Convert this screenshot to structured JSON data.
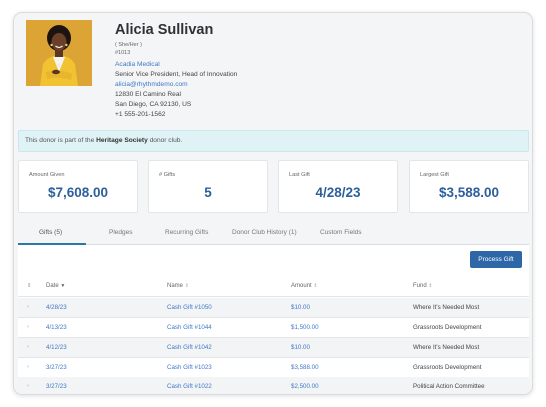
{
  "profile": {
    "name": "Alicia Sullivan",
    "pronouns": "( She/Her )",
    "id": "#1013",
    "organization": "Acadia Medical",
    "title": "Senior Vice President, Head of Innovation",
    "email": "alicia@rhythmdemo.com",
    "address_line1": "12830 El Camino Real",
    "address_line2": "San Diego, CA 92130, US",
    "phone": "+1 555-201-1562"
  },
  "banner": {
    "prefix": "This donor is part of the ",
    "club": "Heritage Society",
    "suffix": " donor club."
  },
  "stats": [
    {
      "label": "Amount Given",
      "value": "$7,608.00"
    },
    {
      "label": "# Gifts",
      "value": "5"
    },
    {
      "label": "Last Gift",
      "value": "4/28/23"
    },
    {
      "label": "Largest Gift",
      "value": "$3,588.00"
    }
  ],
  "tabs": [
    {
      "label": "Gifts (5)"
    },
    {
      "label": "Pledges"
    },
    {
      "label": "Recurring Gifts"
    },
    {
      "label": "Donor Club History (1)"
    },
    {
      "label": "Custom Fields"
    }
  ],
  "actions": {
    "process_gift": "Process Gift"
  },
  "table": {
    "columns": [
      "Date",
      "Name",
      "Amount",
      "Fund"
    ],
    "rows": [
      {
        "date": "4/28/23",
        "name": "Cash Gift #1050",
        "amount": "$10.00",
        "fund": "Where It's Needed Most"
      },
      {
        "date": "4/13/23",
        "name": "Cash Gift #1044",
        "amount": "$1,500.00",
        "fund": "Grassroots Development"
      },
      {
        "date": "4/12/23",
        "name": "Cash Gift #1042",
        "amount": "$10.00",
        "fund": "Where It's Needed Most"
      },
      {
        "date": "3/27/23",
        "name": "Cash Gift #1023",
        "amount": "$3,588.00",
        "fund": "Grassroots Development"
      },
      {
        "date": "3/27/23",
        "name": "Cash Gift #1022",
        "amount": "$2,500.00",
        "fund": "Political Action Committee"
      }
    ]
  },
  "icons": {
    "sort": "sort-icon",
    "sort_active": "sort-desc-icon",
    "expand": "chevron-right-icon"
  }
}
